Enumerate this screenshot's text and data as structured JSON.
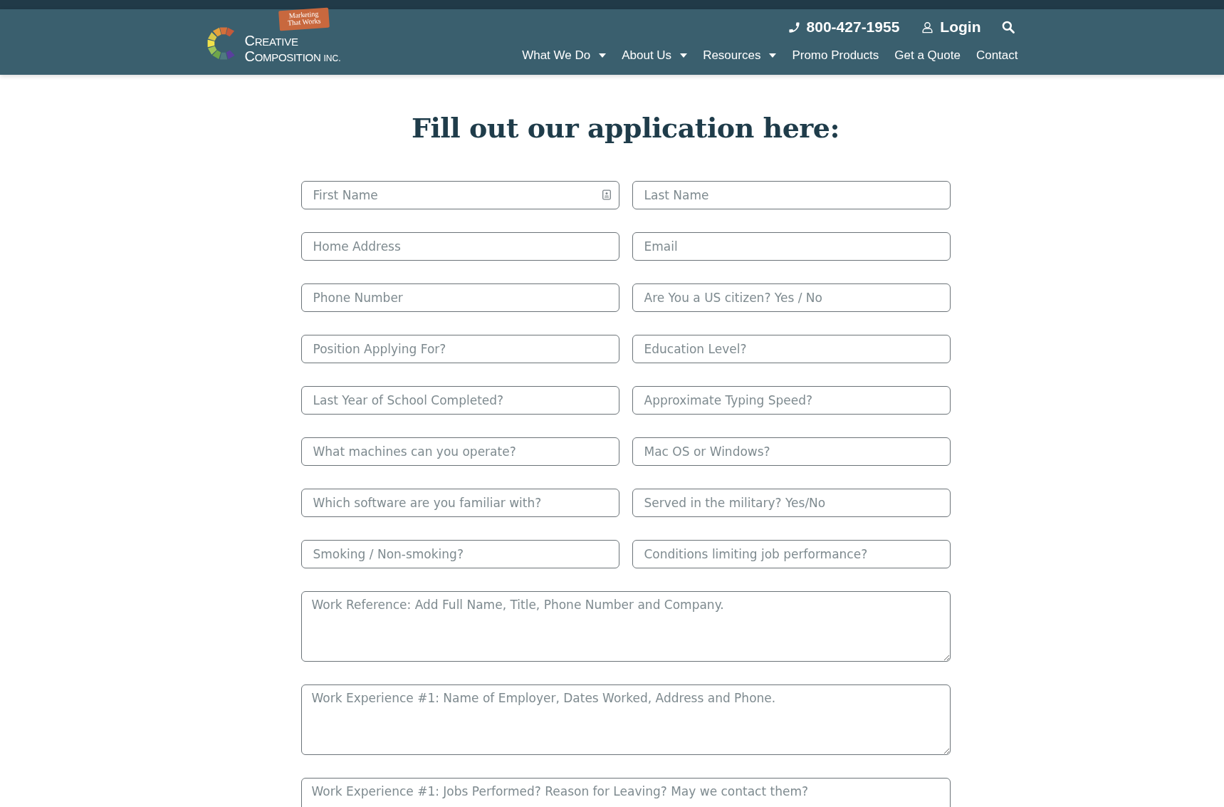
{
  "header": {
    "logo": {
      "badge": "Marketing That Works",
      "line_1": "CREATIVE",
      "line_2": "COMPOSITION",
      "suffix": "INC."
    },
    "phone": "800-427-1955",
    "login": "Login",
    "nav": [
      {
        "label": "What We Do",
        "dropdown": true
      },
      {
        "label": "About Us",
        "dropdown": true
      },
      {
        "label": "Resources",
        "dropdown": true
      },
      {
        "label": "Promo Products",
        "dropdown": false
      },
      {
        "label": "Get a Quote",
        "dropdown": false
      },
      {
        "label": "Contact",
        "dropdown": false
      }
    ]
  },
  "form": {
    "title": "Fill out our application here:",
    "fields": [
      {
        "kind": "input",
        "placeholder": "First Name",
        "contact_icon": true
      },
      {
        "kind": "input",
        "placeholder": "Last Name",
        "contact_icon": false
      },
      {
        "kind": "input",
        "placeholder": "Home Address",
        "contact_icon": false
      },
      {
        "kind": "input",
        "placeholder": "Email",
        "contact_icon": false
      },
      {
        "kind": "input",
        "placeholder": "Phone Number",
        "contact_icon": false
      },
      {
        "kind": "input",
        "placeholder": "Are You a US citizen? Yes / No",
        "contact_icon": false
      },
      {
        "kind": "input",
        "placeholder": "Position Applying For?",
        "contact_icon": false
      },
      {
        "kind": "input",
        "placeholder": "Education Level?",
        "contact_icon": false
      },
      {
        "kind": "input",
        "placeholder": "Last Year of School Completed?",
        "contact_icon": false
      },
      {
        "kind": "input",
        "placeholder": "Approximate Typing Speed?",
        "contact_icon": false
      },
      {
        "kind": "input",
        "placeholder": "What machines can you operate?",
        "contact_icon": false
      },
      {
        "kind": "input",
        "placeholder": "Mac OS or Windows?",
        "contact_icon": false
      },
      {
        "kind": "input",
        "placeholder": "Which software are you familiar with?",
        "contact_icon": false
      },
      {
        "kind": "input",
        "placeholder": "Served in the military? Yes/No",
        "contact_icon": false
      },
      {
        "kind": "input",
        "placeholder": "Smoking / Non-smoking?",
        "contact_icon": false
      },
      {
        "kind": "input",
        "placeholder": "Conditions limiting job performance?",
        "contact_icon": false
      },
      {
        "kind": "textarea",
        "placeholder": "Work Reference: Add Full Name, Title, Phone Number and Company."
      },
      {
        "kind": "textarea",
        "placeholder": "Work Experience #1: Name of Employer, Dates Worked, Address and Phone."
      },
      {
        "kind": "textarea",
        "placeholder": "Work Experience #1: Jobs Performed? Reason for Leaving? May we contact them?"
      }
    ]
  }
}
